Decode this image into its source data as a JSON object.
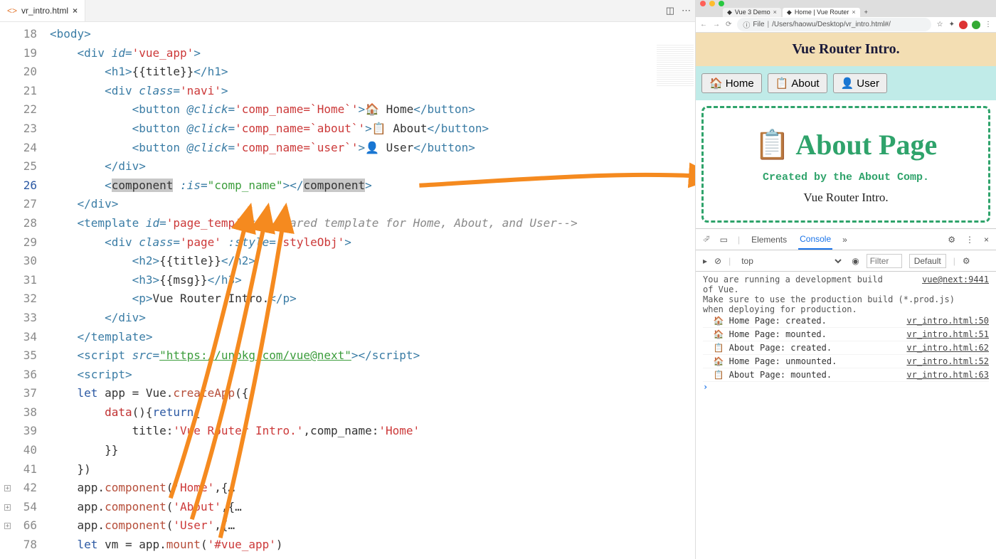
{
  "editor": {
    "tab": {
      "filename": "vr_intro.html"
    },
    "line_numbers": [
      "18",
      "19",
      "20",
      "21",
      "22",
      "23",
      "24",
      "25",
      "26",
      "27",
      "28",
      "29",
      "30",
      "31",
      "32",
      "33",
      "34",
      "35",
      "36",
      "37",
      "38",
      "39",
      "40",
      "41",
      "42",
      "54",
      "66",
      "78"
    ],
    "fold_lines": [
      "42",
      "54",
      "66"
    ],
    "code": {
      "18": [
        [
          "tag",
          "<body>"
        ]
      ],
      "19": [
        [
          "plain",
          "    "
        ],
        [
          "tag",
          "<div "
        ],
        [
          "attr",
          "id"
        ],
        [
          "tag",
          "="
        ],
        [
          "str",
          "'vue_app'"
        ],
        [
          "tag",
          ">"
        ]
      ],
      "20": [
        [
          "plain",
          "        "
        ],
        [
          "tag",
          "<h1>"
        ],
        [
          "plain",
          "{{title}}"
        ],
        [
          "tag",
          "</h1>"
        ]
      ],
      "21": [
        [
          "plain",
          "        "
        ],
        [
          "tag",
          "<div "
        ],
        [
          "attr",
          "class"
        ],
        [
          "tag",
          "="
        ],
        [
          "str",
          "'navi'"
        ],
        [
          "tag",
          ">"
        ]
      ],
      "22": [
        [
          "plain",
          "            "
        ],
        [
          "tag",
          "<button "
        ],
        [
          "attr",
          "@click"
        ],
        [
          "tag",
          "="
        ],
        [
          "str",
          "'comp_name=`Home`'"
        ],
        [
          "tag",
          ">"
        ],
        [
          "plain",
          "🏠 Home"
        ],
        [
          "tag",
          "</button>"
        ]
      ],
      "23": [
        [
          "plain",
          "            "
        ],
        [
          "tag",
          "<button "
        ],
        [
          "attr",
          "@click"
        ],
        [
          "tag",
          "="
        ],
        [
          "str",
          "'comp_name=`about`'"
        ],
        [
          "tag",
          ">"
        ],
        [
          "plain",
          "📋 About"
        ],
        [
          "tag",
          "</button>"
        ]
      ],
      "24": [
        [
          "plain",
          "            "
        ],
        [
          "tag",
          "<button "
        ],
        [
          "attr",
          "@click"
        ],
        [
          "tag",
          "="
        ],
        [
          "str",
          "'comp_name=`user`'"
        ],
        [
          "tag",
          ">"
        ],
        [
          "plain",
          "👤 User"
        ],
        [
          "tag",
          "</button>"
        ]
      ],
      "25": [
        [
          "plain",
          "        "
        ],
        [
          "tag",
          "</div>"
        ]
      ],
      "26": [
        [
          "plain",
          "        "
        ],
        [
          "tag",
          "<"
        ],
        [
          "hl",
          "component"
        ],
        [
          "plain",
          " "
        ],
        [
          "attr",
          ":is"
        ],
        [
          "tag",
          "="
        ],
        [
          "strg",
          "\"comp_name\""
        ],
        [
          "tag",
          "></"
        ],
        [
          "hl",
          "component"
        ],
        [
          "tag",
          ">"
        ]
      ],
      "27": [
        [
          "plain",
          "    "
        ],
        [
          "tag",
          "</div>"
        ]
      ],
      "28": [
        [
          "plain",
          "    "
        ],
        [
          "tag",
          "<template "
        ],
        [
          "attr",
          "id"
        ],
        [
          "tag",
          "="
        ],
        [
          "str",
          "'page_temp'"
        ],
        [
          "tag",
          ">"
        ],
        [
          "cmt",
          "<!--shared template for Home, About, and User-->"
        ]
      ],
      "29": [
        [
          "plain",
          "        "
        ],
        [
          "tag",
          "<div "
        ],
        [
          "attr",
          "class"
        ],
        [
          "tag",
          "="
        ],
        [
          "str",
          "'page'"
        ],
        [
          "plain",
          " "
        ],
        [
          "attr",
          ":style"
        ],
        [
          "tag",
          "="
        ],
        [
          "str",
          "'styleObj'"
        ],
        [
          "tag",
          ">"
        ]
      ],
      "30": [
        [
          "plain",
          "            "
        ],
        [
          "tag",
          "<h2>"
        ],
        [
          "plain",
          "{{title}}"
        ],
        [
          "tag",
          "</h2>"
        ]
      ],
      "31": [
        [
          "plain",
          "            "
        ],
        [
          "tag",
          "<h3>"
        ],
        [
          "plain",
          "{{msg}}"
        ],
        [
          "tag",
          "</h3>"
        ]
      ],
      "32": [
        [
          "plain",
          "            "
        ],
        [
          "tag",
          "<p>"
        ],
        [
          "plain",
          "Vue Router Intro."
        ],
        [
          "tag",
          "</p>"
        ]
      ],
      "33": [
        [
          "plain",
          "        "
        ],
        [
          "tag",
          "</div>"
        ]
      ],
      "34": [
        [
          "plain",
          "    "
        ],
        [
          "tag",
          "</template>"
        ]
      ],
      "35": [
        [
          "plain",
          "    "
        ],
        [
          "tag",
          "<script "
        ],
        [
          "attr",
          "src"
        ],
        [
          "tag",
          "="
        ],
        [
          "url",
          "\"https://unpkg.com/vue@next\""
        ],
        [
          "tag",
          "></"
        ],
        [
          "tag",
          "script>"
        ]
      ],
      "36": [
        [
          "plain",
          "    "
        ],
        [
          "tag",
          "<script>"
        ]
      ],
      "37": [
        [
          "plain",
          "    "
        ],
        [
          "kw",
          "let"
        ],
        [
          "plain",
          " app = Vue."
        ],
        [
          "fn",
          "createApp"
        ],
        [
          "plain",
          "({"
        ]
      ],
      "38": [
        [
          "plain",
          "        "
        ],
        [
          "prop",
          "data"
        ],
        [
          "plain",
          "(){"
        ],
        [
          "kw",
          "return"
        ],
        [
          "plain",
          "{"
        ]
      ],
      "39": [
        [
          "plain",
          "            title:"
        ],
        [
          "str",
          "'Vue Router Intro.'"
        ],
        [
          "plain",
          ",comp_name:"
        ],
        [
          "str",
          "'Home'"
        ]
      ],
      "40": [
        [
          "plain",
          "        }}"
        ]
      ],
      "41": [
        [
          "plain",
          "    })"
        ]
      ],
      "42": [
        [
          "plain",
          "    app."
        ],
        [
          "fn",
          "component"
        ],
        [
          "plain",
          "("
        ],
        [
          "str",
          "'Home'"
        ],
        [
          "plain",
          ",{…"
        ]
      ],
      "54": [
        [
          "plain",
          "    app."
        ],
        [
          "fn",
          "component"
        ],
        [
          "plain",
          "("
        ],
        [
          "str",
          "'About'"
        ],
        [
          "plain",
          ",{…"
        ]
      ],
      "66": [
        [
          "plain",
          "    app."
        ],
        [
          "fn",
          "component"
        ],
        [
          "plain",
          "("
        ],
        [
          "str",
          "'User'"
        ],
        [
          "plain",
          ",{…"
        ]
      ],
      "78": [
        [
          "plain",
          "    "
        ],
        [
          "kw",
          "let"
        ],
        [
          "plain",
          " vm = app."
        ],
        [
          "fn",
          "mount"
        ],
        [
          "plain",
          "("
        ],
        [
          "str",
          "'#vue_app'"
        ],
        [
          "plain",
          ")"
        ]
      ]
    }
  },
  "browser": {
    "tabs": [
      {
        "title": "Vue 3 Demo",
        "active": false
      },
      {
        "title": "Home | Vue Router",
        "active": true
      }
    ],
    "address": {
      "scheme": "File",
      "path": "/Users/haowu/Desktop/vr_intro.html#/"
    },
    "page": {
      "banner": "Vue Router Intro.",
      "nav": [
        {
          "icon": "🏠",
          "label": "Home"
        },
        {
          "icon": "📋",
          "label": "About"
        },
        {
          "icon": "👤",
          "label": "User"
        }
      ],
      "card": {
        "icon": "📋",
        "title": "About Page",
        "subtitle": "Created by the About Comp.",
        "body": "Vue Router Intro."
      }
    }
  },
  "devtools": {
    "tabs": [
      "Elements",
      "Console"
    ],
    "active_tab": "Console",
    "context": "top",
    "filter_placeholder": "Filter",
    "level": "Default",
    "warning_lines": [
      "You are running a development build",
      "of Vue.",
      "Make sure to use the production build (*.prod.js)",
      "when deploying for production."
    ],
    "warning_link": "vue@next:9441",
    "logs": [
      {
        "icon": "🏠",
        "msg": "Home Page: created.",
        "src": "vr_intro.html:50"
      },
      {
        "icon": "🏠",
        "msg": "Home Page: mounted.",
        "src": "vr_intro.html:51"
      },
      {
        "icon": "📋",
        "msg": "About Page: created.",
        "src": "vr_intro.html:62"
      },
      {
        "icon": "🏠",
        "msg": "Home Page: unmounted.",
        "src": "vr_intro.html:52"
      },
      {
        "icon": "📋",
        "msg": "About Page: mounted.",
        "src": "vr_intro.html:63"
      }
    ]
  }
}
